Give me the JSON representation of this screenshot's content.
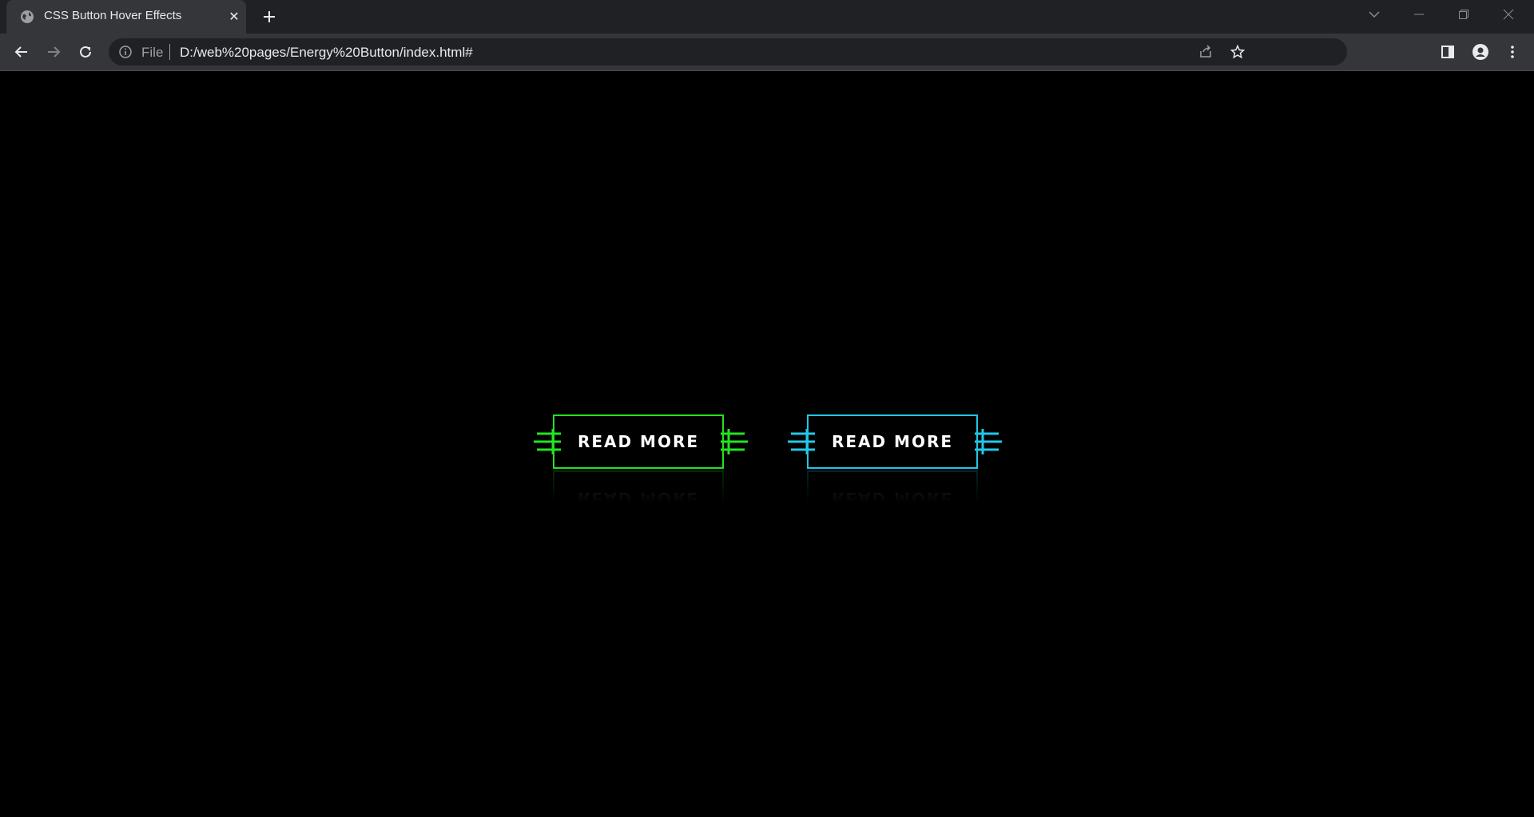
{
  "browser": {
    "tab_title": "CSS Button Hover Effects",
    "tab_close": "✕",
    "address_scheme": "File",
    "address_url": "D:/web%20pages/Energy%20Button/index.html#"
  },
  "buttons": [
    {
      "label": "READ MORE",
      "color": "#22e322"
    },
    {
      "label": "READ MORE",
      "color": "#22c7e6"
    }
  ],
  "colors": {
    "page_background": "#000000",
    "chrome_dark": "#202124",
    "chrome_toolbar": "#35363a"
  }
}
